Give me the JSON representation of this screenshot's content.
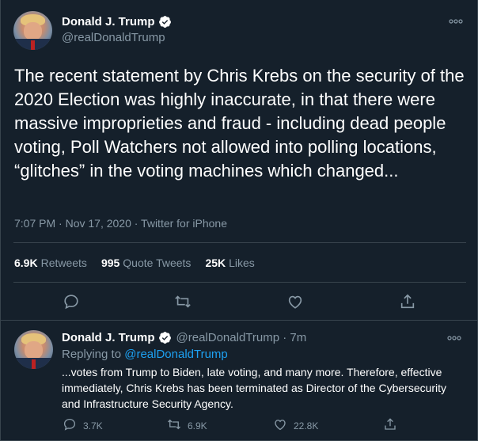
{
  "main_tweet": {
    "author_name": "Donald J. Trump",
    "author_handle": "@realDonaldTrump",
    "text": "The recent statement by Chris Krebs on the security of the 2020 Election was highly inaccurate, in that there were massive improprieties and fraud - including dead people voting, Poll Watchers not allowed into polling locations, “glitches” in the voting machines which changed...",
    "timestamp": "7:07 PM · Nov 17, 2020 · Twitter for iPhone",
    "retweets_count": "6.9K",
    "retweets_label": "Retweets",
    "quotes_count": "995",
    "quotes_label": "Quote Tweets",
    "likes_count": "25K",
    "likes_label": "Likes",
    "more_icon": "more-icon"
  },
  "reply_tweet": {
    "author_name": "Donald J. Trump",
    "author_handle": "@realDonaldTrump · 7m",
    "replying_prefix": "Replying to ",
    "replying_handle": "@realDonaldTrump",
    "text": "...votes from Trump to Biden, late voting, and many more. Therefore, effective immediately, Chris Krebs has been terminated as Director of the Cybersecurity and Infrastructure Security Agency.",
    "reply_count": "3.7K",
    "retweet_count": "6.9K",
    "like_count": "22.8K"
  },
  "colors": {
    "background": "#15202b",
    "border": "#38444d",
    "muted": "#8899a6",
    "accent": "#1da1f2",
    "text": "#ffffff"
  }
}
